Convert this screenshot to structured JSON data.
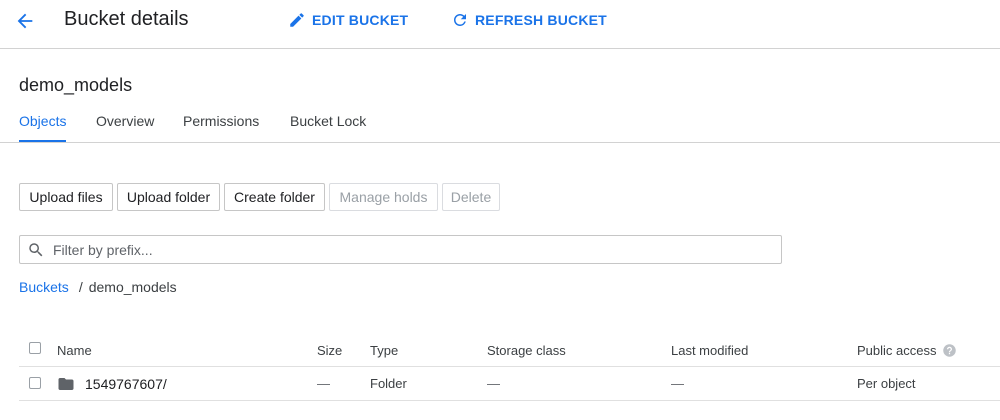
{
  "header": {
    "title": "Bucket details",
    "edit_label": "EDIT BUCKET",
    "refresh_label": "REFRESH BUCKET"
  },
  "bucket": {
    "name": "demo_models"
  },
  "tabs": [
    {
      "label": "Objects",
      "active": true
    },
    {
      "label": "Overview",
      "active": false
    },
    {
      "label": "Permissions",
      "active": false
    },
    {
      "label": "Bucket Lock",
      "active": false
    }
  ],
  "toolbar": {
    "upload_files": "Upload files",
    "upload_folder": "Upload folder",
    "create_folder": "Create folder",
    "manage_holds": "Manage holds",
    "delete": "Delete"
  },
  "filter": {
    "placeholder": "Filter by prefix..."
  },
  "breadcrumb": {
    "root": "Buckets",
    "separator": "/",
    "current": "demo_models"
  },
  "table": {
    "columns": {
      "name": "Name",
      "size": "Size",
      "type": "Type",
      "storage_class": "Storage class",
      "last_modified": "Last modified",
      "public_access": "Public access"
    },
    "rows": [
      {
        "name": "1549767607/",
        "size": "—",
        "type": "Folder",
        "storage_class": "—",
        "last_modified": "—",
        "public_access": "Per object"
      }
    ]
  },
  "colors": {
    "accent": "#1a73e8",
    "icon_gray": "#5f6368"
  },
  "icons": {
    "back": "arrow-back-icon",
    "edit": "pencil-icon",
    "refresh": "refresh-icon",
    "search": "search-icon",
    "folder": "folder-icon",
    "help": "help-icon"
  }
}
